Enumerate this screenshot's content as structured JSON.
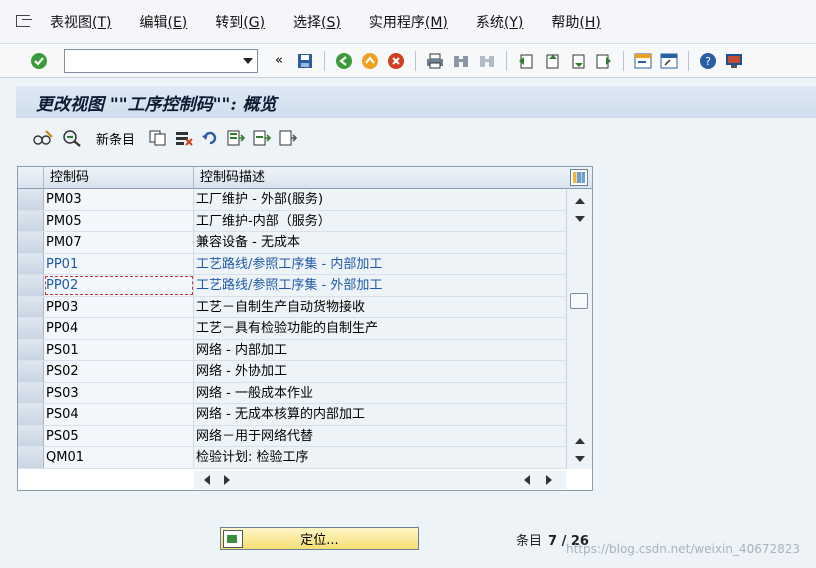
{
  "menu": {
    "items": [
      {
        "label": "表视图",
        "key": "(T)"
      },
      {
        "label": "编辑",
        "key": "(E)"
      },
      {
        "label": "转到",
        "key": "(G)"
      },
      {
        "label": "选择",
        "key": "(S)"
      },
      {
        "label": "实用程序",
        "key": "(M)"
      },
      {
        "label": "系统",
        "key": "(Y)"
      },
      {
        "label": "帮助",
        "key": "(H)"
      }
    ]
  },
  "toolbar": {
    "command_value": "",
    "double_arrow": "«"
  },
  "title": "更改视图 \"\"工序控制码\"\": 概览",
  "app_toolbar": {
    "new_entries": "新条目"
  },
  "table": {
    "columns": [
      "控制码",
      "控制码描述"
    ],
    "rows": [
      {
        "code": "PM03",
        "desc": "工厂维护 - 外部(服务)"
      },
      {
        "code": "PM05",
        "desc": "工厂维护-内部（服务）"
      },
      {
        "code": "PM07",
        "desc": "兼容设备 - 无成本"
      },
      {
        "code": "PP01",
        "desc": "工艺路线/参照工序集 - 内部加工"
      },
      {
        "code": "PP02",
        "desc": "工艺路线/参照工序集 - 外部加工"
      },
      {
        "code": "PP03",
        "desc": "工艺－自制生产自动货物接收"
      },
      {
        "code": "PP04",
        "desc": "工艺－具有检验功能的自制生产"
      },
      {
        "code": "PS01",
        "desc": "网络 - 内部加工"
      },
      {
        "code": "PS02",
        "desc": "网络 - 外协加工"
      },
      {
        "code": "PS03",
        "desc": "网络 - 一般成本作业"
      },
      {
        "code": "PS04",
        "desc": "网络 - 无成本核算的内部加工"
      },
      {
        "code": "PS05",
        "desc": "网络－用于网络代替"
      },
      {
        "code": "QM01",
        "desc": "检验计划: 检验工序"
      }
    ]
  },
  "footer": {
    "position_label": "定位...",
    "entries_label": "条目",
    "entries_value": "7 / 26",
    "watermark": "https://blog.csdn.net/weixin_40672823"
  },
  "colors": {
    "accent_link": "#1d5aa8",
    "title_bg": "#cfdeed",
    "button_yellow": "#f5de72"
  }
}
